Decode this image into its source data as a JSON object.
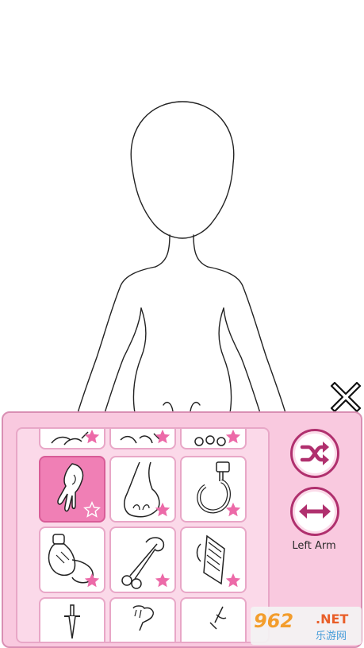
{
  "canvas": {
    "figure": "blank-body-mannequin-outline"
  },
  "close": {
    "icon": "close-icon"
  },
  "panel": {
    "accent": "#f9c9df",
    "items": [
      {
        "icon": "claw-hand-icon",
        "starred": true
      },
      {
        "icon": "claw-hand-icon",
        "starred": true
      },
      {
        "icon": "bone-hand-icon",
        "starred": true
      },
      {
        "icon": "dripping-hand-icon",
        "starred": true,
        "selected": true
      },
      {
        "icon": "paw-icon",
        "starred": true
      },
      {
        "icon": "hook-icon",
        "starred": true
      },
      {
        "icon": "potion-bottle-icon",
        "starred": true
      },
      {
        "icon": "scissors-icon",
        "starred": true
      },
      {
        "icon": "book-icon",
        "starred": true
      },
      {
        "icon": "dagger-icon",
        "starred": false
      },
      {
        "icon": "fist-icon",
        "starred": false
      },
      {
        "icon": "wand-icon",
        "starred": false
      }
    ]
  },
  "side": {
    "shuffle_icon": "shuffle-icon",
    "swap_icon": "swap-arrows-icon",
    "label": "Left Arm"
  },
  "watermark": {
    "num": "962",
    "net": ".NET",
    "cn": "乐游网"
  }
}
